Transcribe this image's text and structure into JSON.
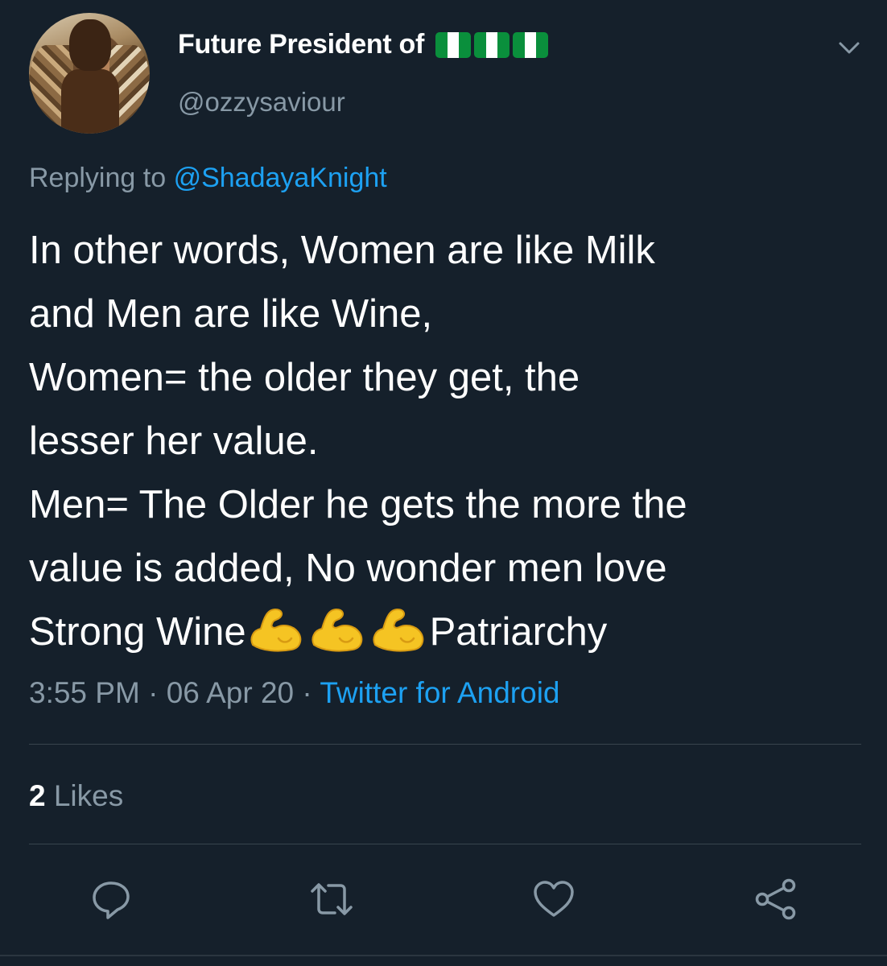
{
  "tweet": {
    "display_name": "Future President of",
    "flag_icons": [
      "nigeria-flag-icon",
      "nigeria-flag-icon",
      "nigeria-flag-icon"
    ],
    "handle": "@ozzysaviour",
    "replying_prefix": "Replying to",
    "replying_mention": "@ShadayaKnight",
    "text_lines": [
      "In other words, Women are like Milk",
      "and Men are like Wine,",
      "Women= the older they get, the",
      "lesser her value.",
      "Men= The Older he gets the more the",
      "value is added, No wonder men love"
    ],
    "last_line_start": "Strong Wine",
    "last_line_emojis": [
      "flexed-biceps-icon",
      "flexed-biceps-icon",
      "flexed-biceps-icon"
    ],
    "last_line_end": "Patriarchy",
    "time": "3:55 PM",
    "separator1": " · ",
    "date": "06 Apr 20",
    "separator2": " · ",
    "source": "Twitter for Android",
    "likes_count": "2",
    "likes_label": "Likes"
  },
  "actions": {
    "reply": "reply-icon",
    "retweet": "retweet-icon",
    "like": "heart-icon",
    "share": "share-icon"
  },
  "colors": {
    "background": "#15202b",
    "accent": "#1da1f2",
    "secondary_text": "#8899a6",
    "divider": "#38444d",
    "flag_green": "#0a8f3c",
    "emoji_yellow": "#f5c423"
  }
}
